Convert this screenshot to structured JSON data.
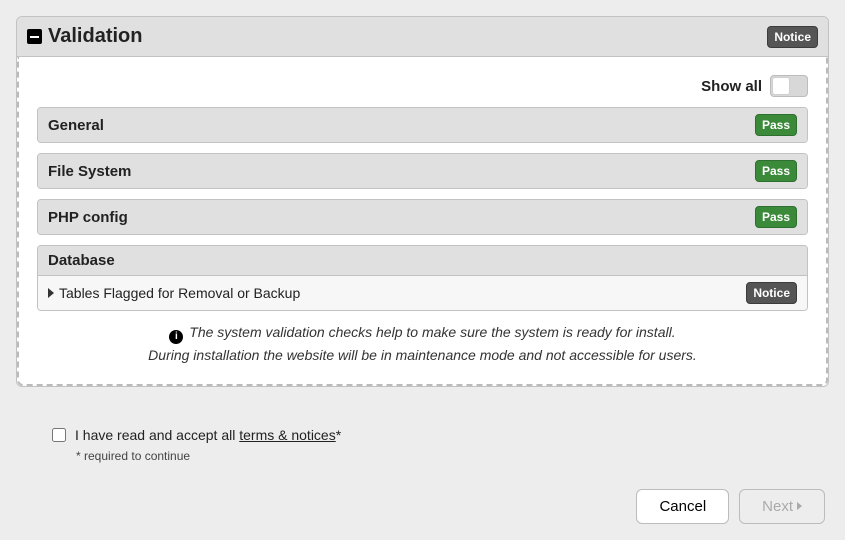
{
  "panel": {
    "title": "Validation",
    "overall_badge": "Notice"
  },
  "show_all": {
    "label": "Show all",
    "checked": false
  },
  "sections": [
    {
      "title": "General",
      "badge": "Pass"
    },
    {
      "title": "File System",
      "badge": "Pass"
    },
    {
      "title": "PHP config",
      "badge": "Pass"
    },
    {
      "title": "Database",
      "badge": null,
      "rows": [
        {
          "label": "Tables Flagged for Removal or Backup",
          "badge": "Notice"
        }
      ]
    }
  ],
  "help": {
    "line1": "The system validation checks help to make sure the system is ready for install.",
    "line2": "During installation the website will be in maintenance mode and not accessible for users."
  },
  "accept": {
    "pre": "I have read and accept all ",
    "link": "terms & notices",
    "post": "*",
    "note": "* required to continue",
    "checked": false
  },
  "buttons": {
    "cancel": "Cancel",
    "next": "Next"
  }
}
